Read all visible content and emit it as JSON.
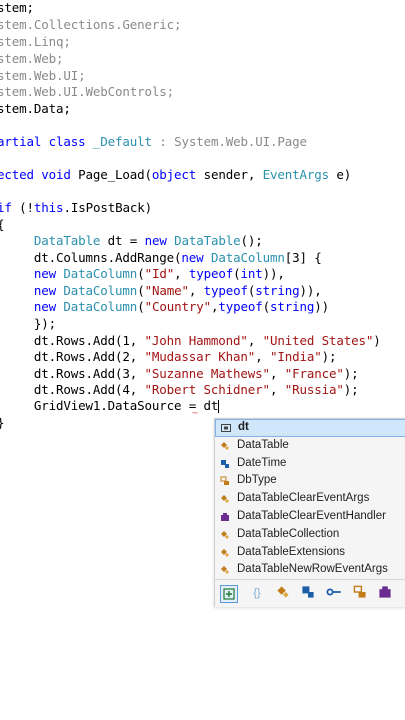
{
  "code": {
    "l1": "stem;",
    "l2": "stem.Collections.Generic;",
    "l3": "stem.Linq;",
    "l4": "stem.Web;",
    "l5": "stem.Web.UI;",
    "l6": "stem.Web.UI.WebControls;",
    "l7": "stem.Data;",
    "l8_kw": "artial class",
    "l8_name": "_Default",
    "l8_base": ": System.Web.UI.Page",
    "l9_kw": "ected void",
    "l9_rest": "Page_Load(",
    "l9_kw2": "object",
    "l9_rest2": "sender,",
    "l9_ty": "EventArgs",
    "l9_rest3": "e)",
    "l10_kw": "if",
    "l10_a": "(!",
    "l10_this": "this",
    "l10_b": ".IsPostBack)",
    "l11": "{",
    "l12_ty": "DataTable",
    "l12_a": "dt =",
    "l12_new": "new",
    "l12_ty2": "DataTable",
    "l12_b": "();",
    "l13_a": "dt.Columns.AddRange(",
    "l13_new": "new",
    "l13_ty": "DataColumn",
    "l13_b": "[3] {",
    "l14_new": "new",
    "l14_ty": "DataColumn",
    "l14_str": "\"Id\"",
    "l14_typeof": "typeof",
    "l14_int": "int",
    "l15_new": "new",
    "l15_ty": "DataColumn",
    "l15_str": "\"Name\"",
    "l15_typeof": "typeof",
    "l15_string": "string",
    "l16_new": "new",
    "l16_ty": "DataColumn",
    "l16_str": "\"Country\"",
    "l16_typeof": "typeof",
    "l16_string": "string",
    "l17": "});",
    "r1_a": "dt.Rows.Add(1,",
    "r1_s1": "\"John Hammond\"",
    "r1_s2": "\"United States\"",
    "r1_b": ")",
    "r2_a": "dt.Rows.Add(2,",
    "r2_s1": "\"Mudassar Khan\"",
    "r2_s2": "\"India\"",
    "r2_b": ");",
    "r3_a": "dt.Rows.Add(3,",
    "r3_s1": "\"Suzanne Mathews\"",
    "r3_s2": "\"France\"",
    "r3_b": ");",
    "r4_a": "dt.Rows.Add(4,",
    "r4_s1": "\"Robert Schidner\"",
    "r4_s2": "\"Russia\"",
    "r4_b": ");",
    "l22": "GridView1.DataSource = dt",
    "l23": "}"
  },
  "intellisense": {
    "items": [
      {
        "label": "dt",
        "icon": "local-variable-icon"
      },
      {
        "label": "DataTable",
        "icon": "class-icon"
      },
      {
        "label": "DateTime",
        "icon": "struct-icon"
      },
      {
        "label": "DbType",
        "icon": "enum-icon"
      },
      {
        "label": "DataTableClearEventArgs",
        "icon": "class-icon"
      },
      {
        "label": "DataTableClearEventHandler",
        "icon": "delegate-icon"
      },
      {
        "label": "DataTableCollection",
        "icon": "class-icon"
      },
      {
        "label": "DataTableExtensions",
        "icon": "class-icon"
      },
      {
        "label": "DataTableNewRowEventArgs",
        "icon": "class-icon"
      }
    ],
    "filters": [
      "expand-filter-icon",
      "namespace-filter-icon",
      "class-filter-icon",
      "struct-filter-icon",
      "interface-filter-icon",
      "enum-filter-icon",
      "delegate-filter-icon"
    ]
  },
  "colors": {
    "keyword": "#0000ff",
    "type": "#2b91af",
    "string": "#a31515",
    "selection": "#cfe6fb"
  }
}
